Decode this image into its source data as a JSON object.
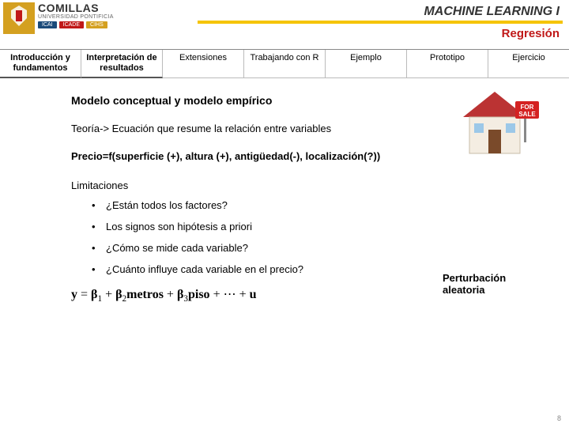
{
  "header": {
    "uni_name": "COMILLAS",
    "uni_sub": "UNIVERSIDAD PONTIFICIA",
    "badges": [
      "ICAI",
      "ICADE",
      "CIHS"
    ],
    "course": "MACHINE LEARNING I",
    "section": "Regresión"
  },
  "tabs": [
    "Introducción y fundamentos",
    "Interpretación de resultados",
    "Extensiones",
    "Trabajando con R",
    "Ejemplo",
    "Prototipo",
    "Ejercicio"
  ],
  "content": {
    "heading": "Modelo conceptual y modelo empírico",
    "theory_line": "Teoría-> Ecuación que resume la relación entre variables",
    "price_formula": "Precio=f(superficie (+), altura (+), antigüedad(-), localización(?))",
    "limit_title": "Limitaciones",
    "limitaciones": [
      "¿Están todos los factores?",
      "Los signos son hipótesis a priori",
      "¿Cómo se mide cada variable?",
      "¿Cuánto influye cada variable en el precio?"
    ],
    "perturbation": "Perturbación aleatoria",
    "equation_terms": {
      "y": "y",
      "b1": "β",
      "b2": "β",
      "b3": "β",
      "v2": "metros",
      "v3": "piso",
      "dots": "⋯",
      "u": "u"
    }
  },
  "housesign": {
    "for": "FOR",
    "sale": "SALE"
  },
  "page_number": "8"
}
